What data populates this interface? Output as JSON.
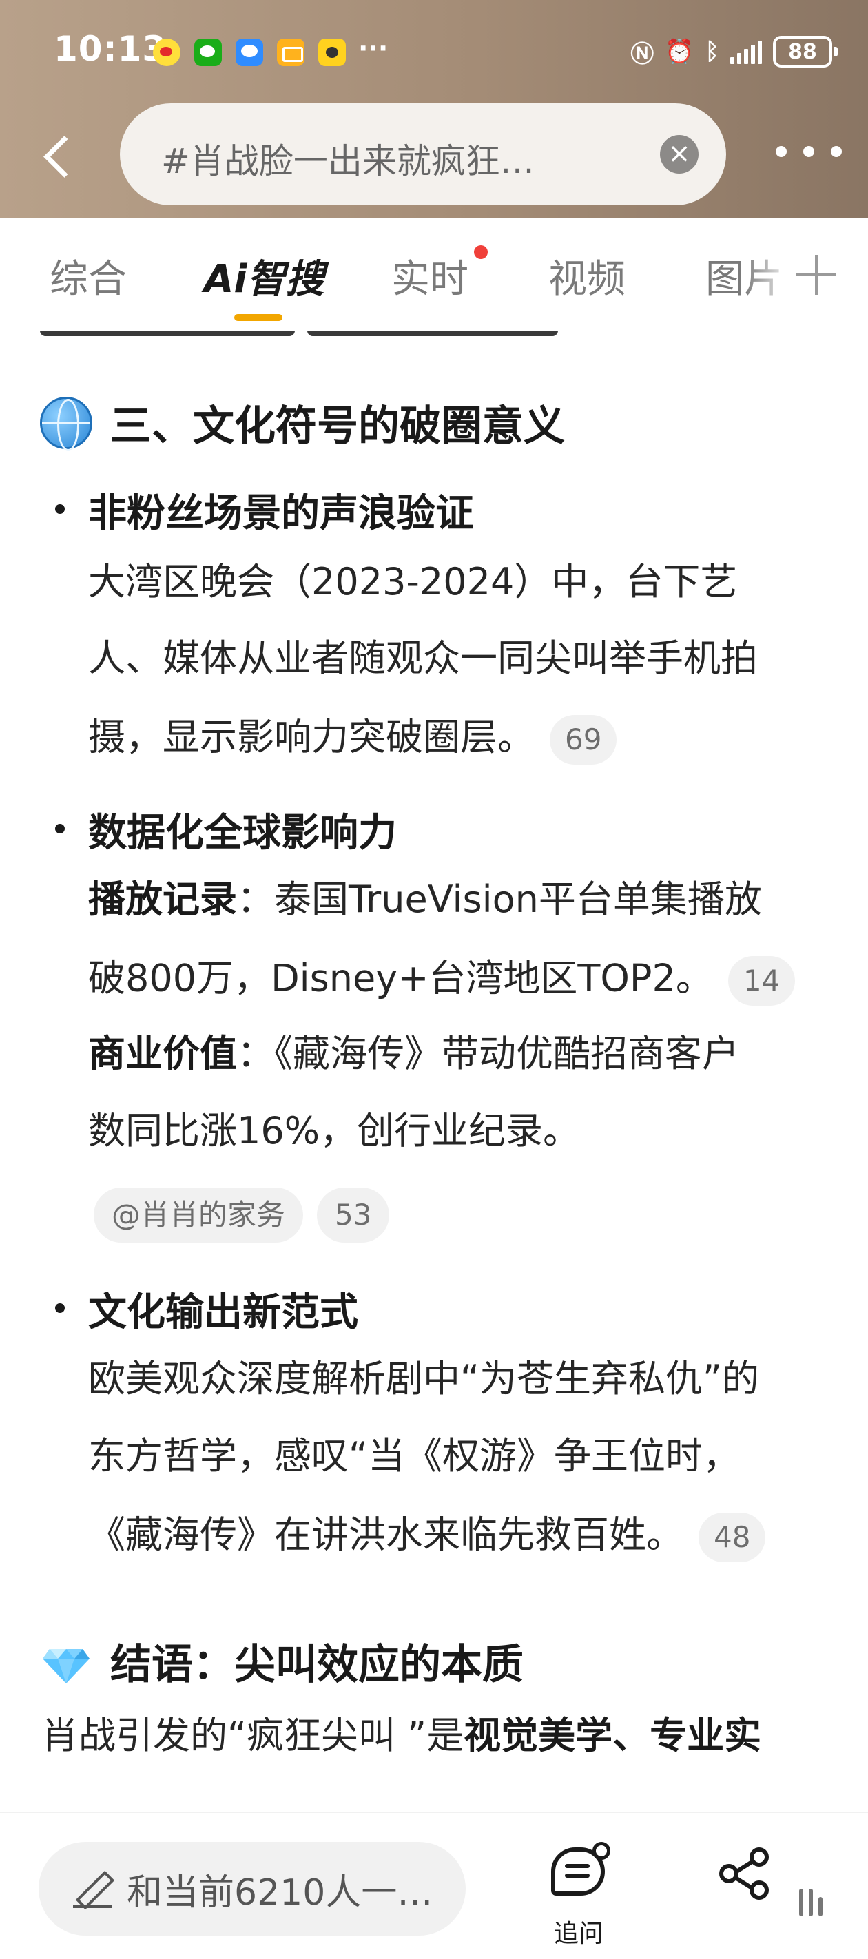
{
  "status_bar": {
    "time": "10:13",
    "notification_icons": [
      "weibo-icon",
      "wechat-icon",
      "message-icon",
      "mail-icon",
      "game-icon"
    ],
    "more": "···",
    "battery": "88"
  },
  "header": {
    "search_query": "#肖战脸一出来就疯狂…",
    "clear_label": "×"
  },
  "tabs": {
    "items": [
      "综合",
      "Ai智搜",
      "实时",
      "视频",
      "图片"
    ],
    "active": "Ai智搜",
    "accent_color": "#f2a600",
    "dot_color": "#f0403a"
  },
  "article": {
    "section3": {
      "emoji": "globe-icon",
      "heading": "三、文化符号的破圈意义",
      "items": [
        {
          "title": "非粉丝场景的声浪验证",
          "lines": [
            "大湾区晚会（2023-2024）中，台下艺",
            "人、媒体从业者随观众一同尖叫举手机拍",
            "摄，显示影响力突破圈层。"
          ],
          "cite": "69"
        },
        {
          "title": "数据化全球影响力",
          "sub1_label": "播放记录",
          "sub1_line1": "：泰国TrueVision平台单集播放",
          "sub1_line2": "破800万，Disney+台湾地区TOP2。",
          "sub1_cite": "14",
          "sub2_label": "商业价值",
          "sub2_line1": "：《藏海传》带动优酷招商客户",
          "sub2_line2": "数同比涨16%，创行业纪录。",
          "source_chip": "@肖肖的家务",
          "source_cite": "53"
        },
        {
          "title": "文化输出新范式",
          "lines": [
            "欧美观众深度解析剧中“为苍生弃私仇”的",
            "东方哲学，感叹“当《权游》争王位时，",
            "《藏海传》在讲洪水来临先救百姓。"
          ],
          "cite": "48"
        }
      ]
    },
    "conclusion": {
      "emoji": "gem-icon",
      "heading": "结语：尖叫效应的本质",
      "line_prefix": "肖战引发的“疯狂尖叫 ”是",
      "line_bold": "视觉美学、专业实"
    }
  },
  "bottom_bar": {
    "ask_placeholder": "和当前6210人一…",
    "follow_label": "追问",
    "share_icon": "share-icon"
  }
}
